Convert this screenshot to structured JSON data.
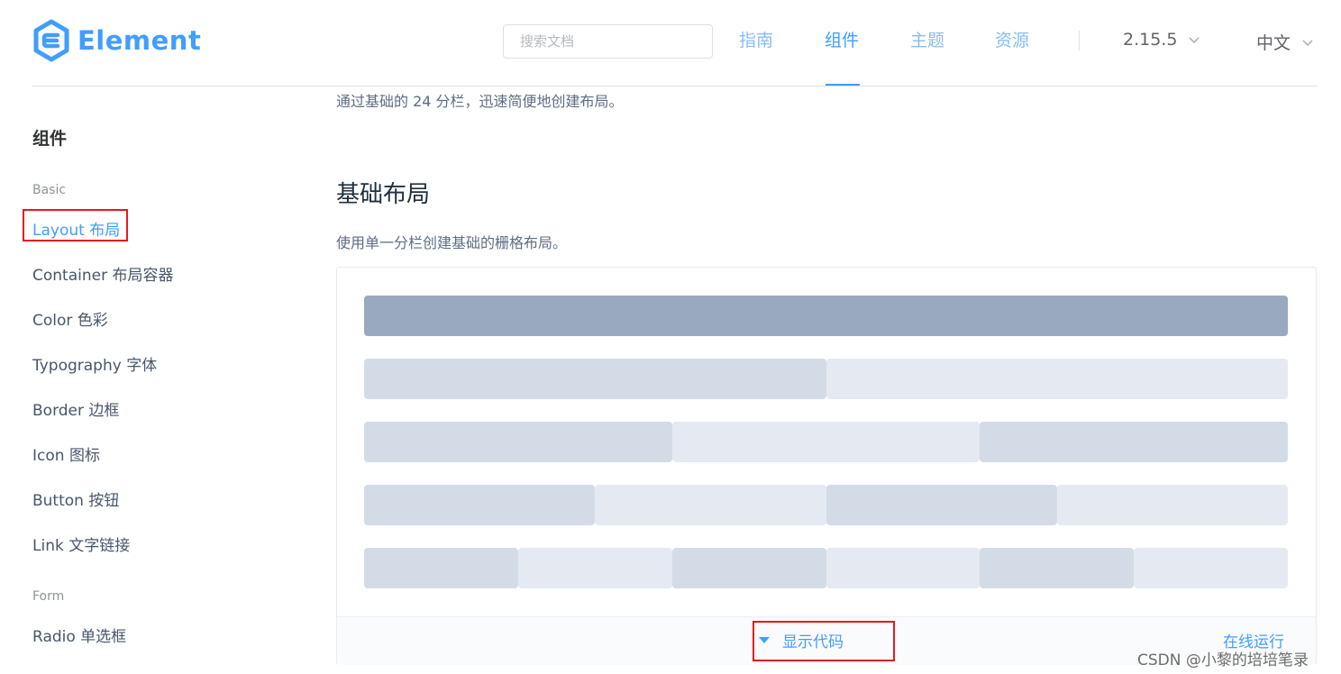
{
  "header": {
    "logo_text": "Element",
    "search_placeholder": "搜索文档",
    "nav": [
      {
        "label": "指南"
      },
      {
        "label": "组件"
      },
      {
        "label": "主题"
      },
      {
        "label": "资源"
      }
    ],
    "version": "2.15.5",
    "language": "中文"
  },
  "sidebar": {
    "title": "组件",
    "groups": [
      {
        "label": "Basic"
      },
      {
        "label": "Form"
      }
    ],
    "items": [
      {
        "label": "Layout 布局"
      },
      {
        "label": "Container 布局容器"
      },
      {
        "label": "Color 色彩"
      },
      {
        "label": "Typography 字体"
      },
      {
        "label": "Border 边框"
      },
      {
        "label": "Icon 图标"
      },
      {
        "label": "Button 按钮"
      },
      {
        "label": "Link 文字链接"
      },
      {
        "label": "Radio 单选框"
      }
    ]
  },
  "content": {
    "intro": "通过基础的 24 分栏，迅速简便地创建布局。",
    "section_title": "基础布局",
    "section_desc": "使用单一分栏创建基础的栅格布局。",
    "grid_rows_spans": [
      [
        24
      ],
      [
        12,
        12
      ],
      [
        8,
        8,
        8
      ],
      [
        6,
        6,
        6,
        6
      ],
      [
        4,
        4,
        4,
        4,
        4,
        4
      ]
    ],
    "show_code": "显示代码",
    "run_online": "在线运行"
  },
  "watermark": "CSDN @小黎的培培笔录",
  "colors": {
    "accent": "#409eff",
    "grid_dark": "#99a9bf",
    "grid_mid": "#d3dce6",
    "grid_light": "#e5e9f2",
    "highlight_box": "#e5191c"
  }
}
